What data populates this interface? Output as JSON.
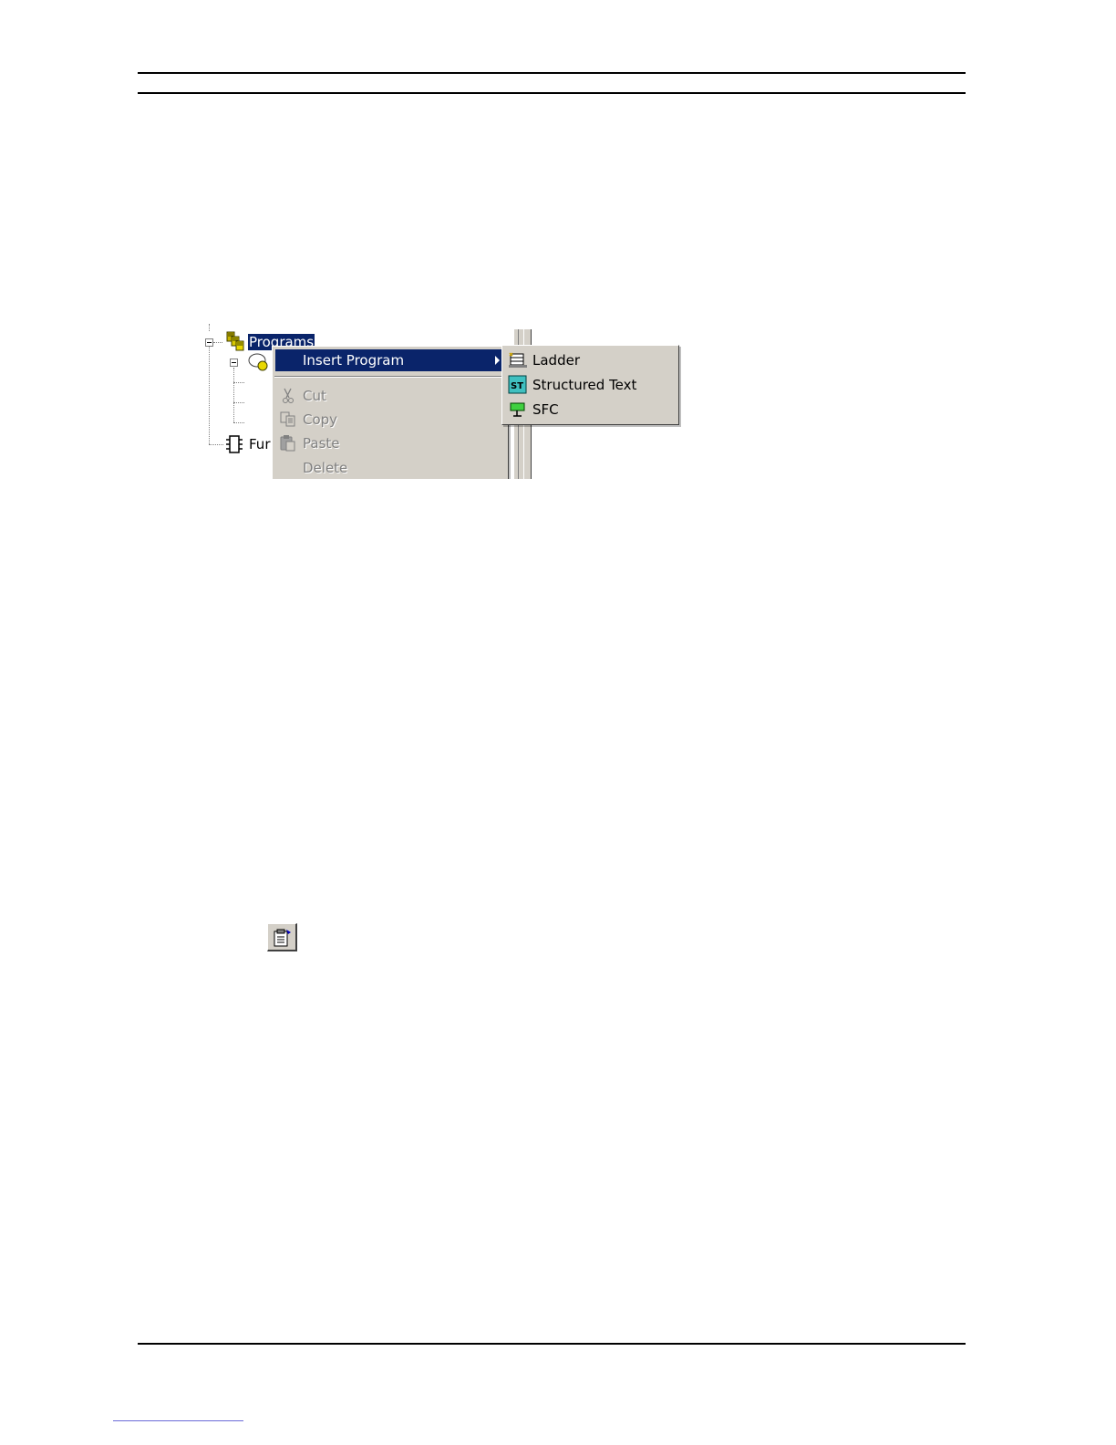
{
  "tree": {
    "programs_label": "Programs",
    "func_label_partial": "Fur"
  },
  "context_menu": {
    "items": [
      {
        "label": "Insert Program",
        "state": "highlighted",
        "has_submenu": true,
        "icon": "none"
      },
      {
        "label": "Cut",
        "state": "disabled",
        "icon": "scissors-icon"
      },
      {
        "label": "Copy",
        "state": "disabled",
        "icon": "copy-icon"
      },
      {
        "label": "Paste",
        "state": "disabled",
        "icon": "paste-icon"
      },
      {
        "label": "Delete",
        "state": "disabled",
        "icon": "none"
      }
    ]
  },
  "submenu": {
    "items": [
      {
        "label": "Ladder",
        "icon": "ladder-icon"
      },
      {
        "label": "Structured Text",
        "icon": "structured-text-icon"
      },
      {
        "label": "SFC",
        "icon": "sfc-icon"
      }
    ]
  },
  "colors": {
    "menu_bg": "#d4d0c8",
    "highlight": "#0a246a",
    "disabled_text": "#808080"
  },
  "toolbar_icon": "properties-icon"
}
